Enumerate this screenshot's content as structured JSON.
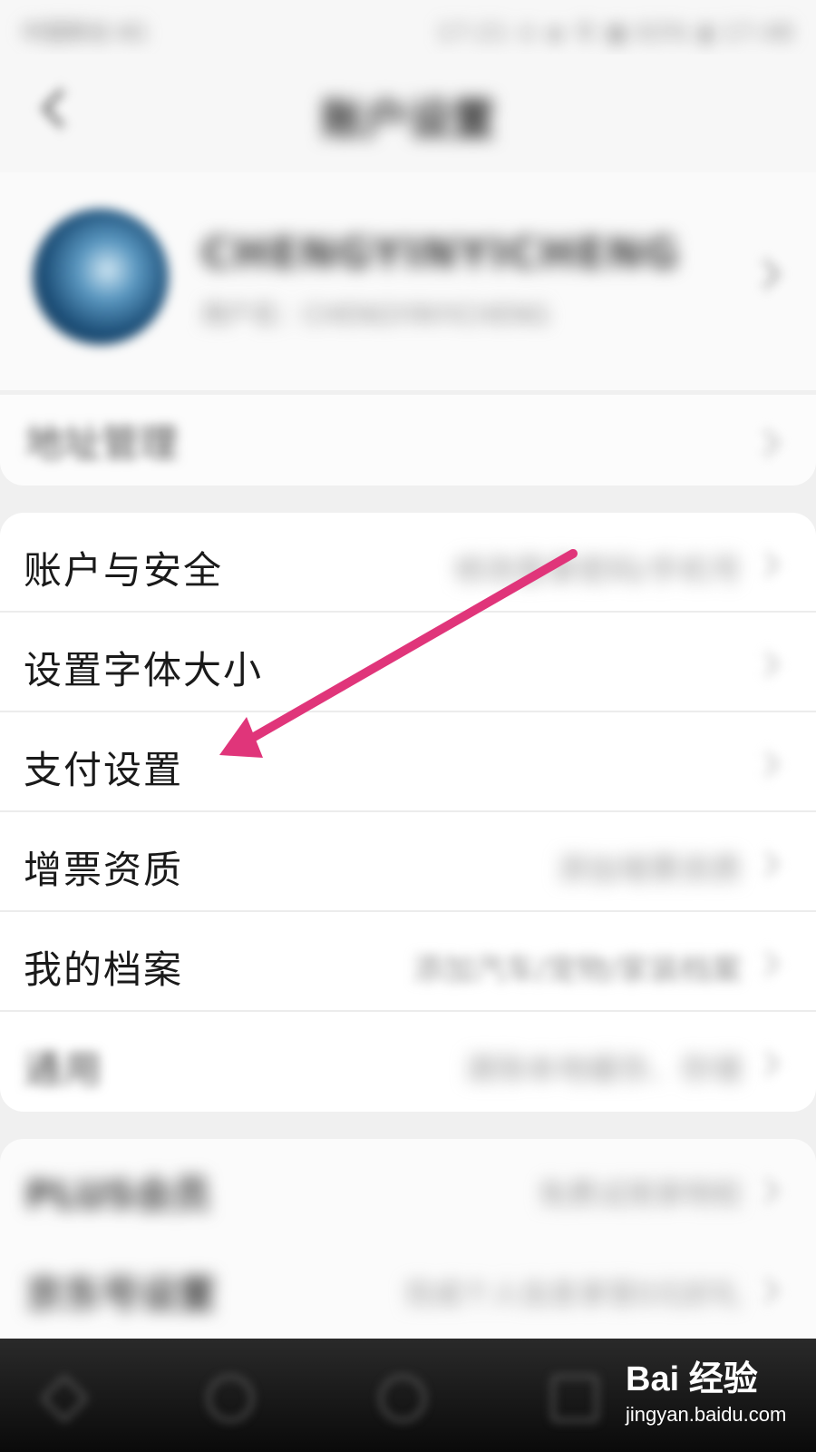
{
  "status_bar": {
    "left_text": "中国移动 4G",
    "right_text": "17:21 ⊙ ◈ 令 ▦ 63% ▮ 17:48"
  },
  "header": {
    "title": "账户设置"
  },
  "profile": {
    "name": "CHENGYINYICHENG",
    "subtitle": "用户名：CHENGYINYICHENG"
  },
  "address": {
    "label": "地址管理"
  },
  "settings_list": [
    {
      "label": "账户与安全",
      "value": "修改登录密码/手机号"
    },
    {
      "label": "设置字体大小",
      "value": ""
    },
    {
      "label": "支付设置",
      "value": ""
    },
    {
      "label": "增票资质",
      "value": "添加增票资质"
    },
    {
      "label": "我的档案",
      "value": "添加汽车/宠物/家装档案"
    },
    {
      "label": "通用",
      "value": "清除本地缓存、存储"
    }
  ],
  "lower_list": [
    {
      "label": "PLUS会员",
      "value": "免费试用享特权"
    },
    {
      "label": "京东号设置",
      "value": "完成个人信息享受0元好礼"
    }
  ],
  "watermark": {
    "brand": "Bai 经验",
    "url": "jingyan.baidu.com"
  },
  "colors": {
    "arrow": "#e0357a",
    "page_background": "#f0f0f0",
    "card_background": "#ffffff",
    "bottom_nav": "#111111"
  }
}
